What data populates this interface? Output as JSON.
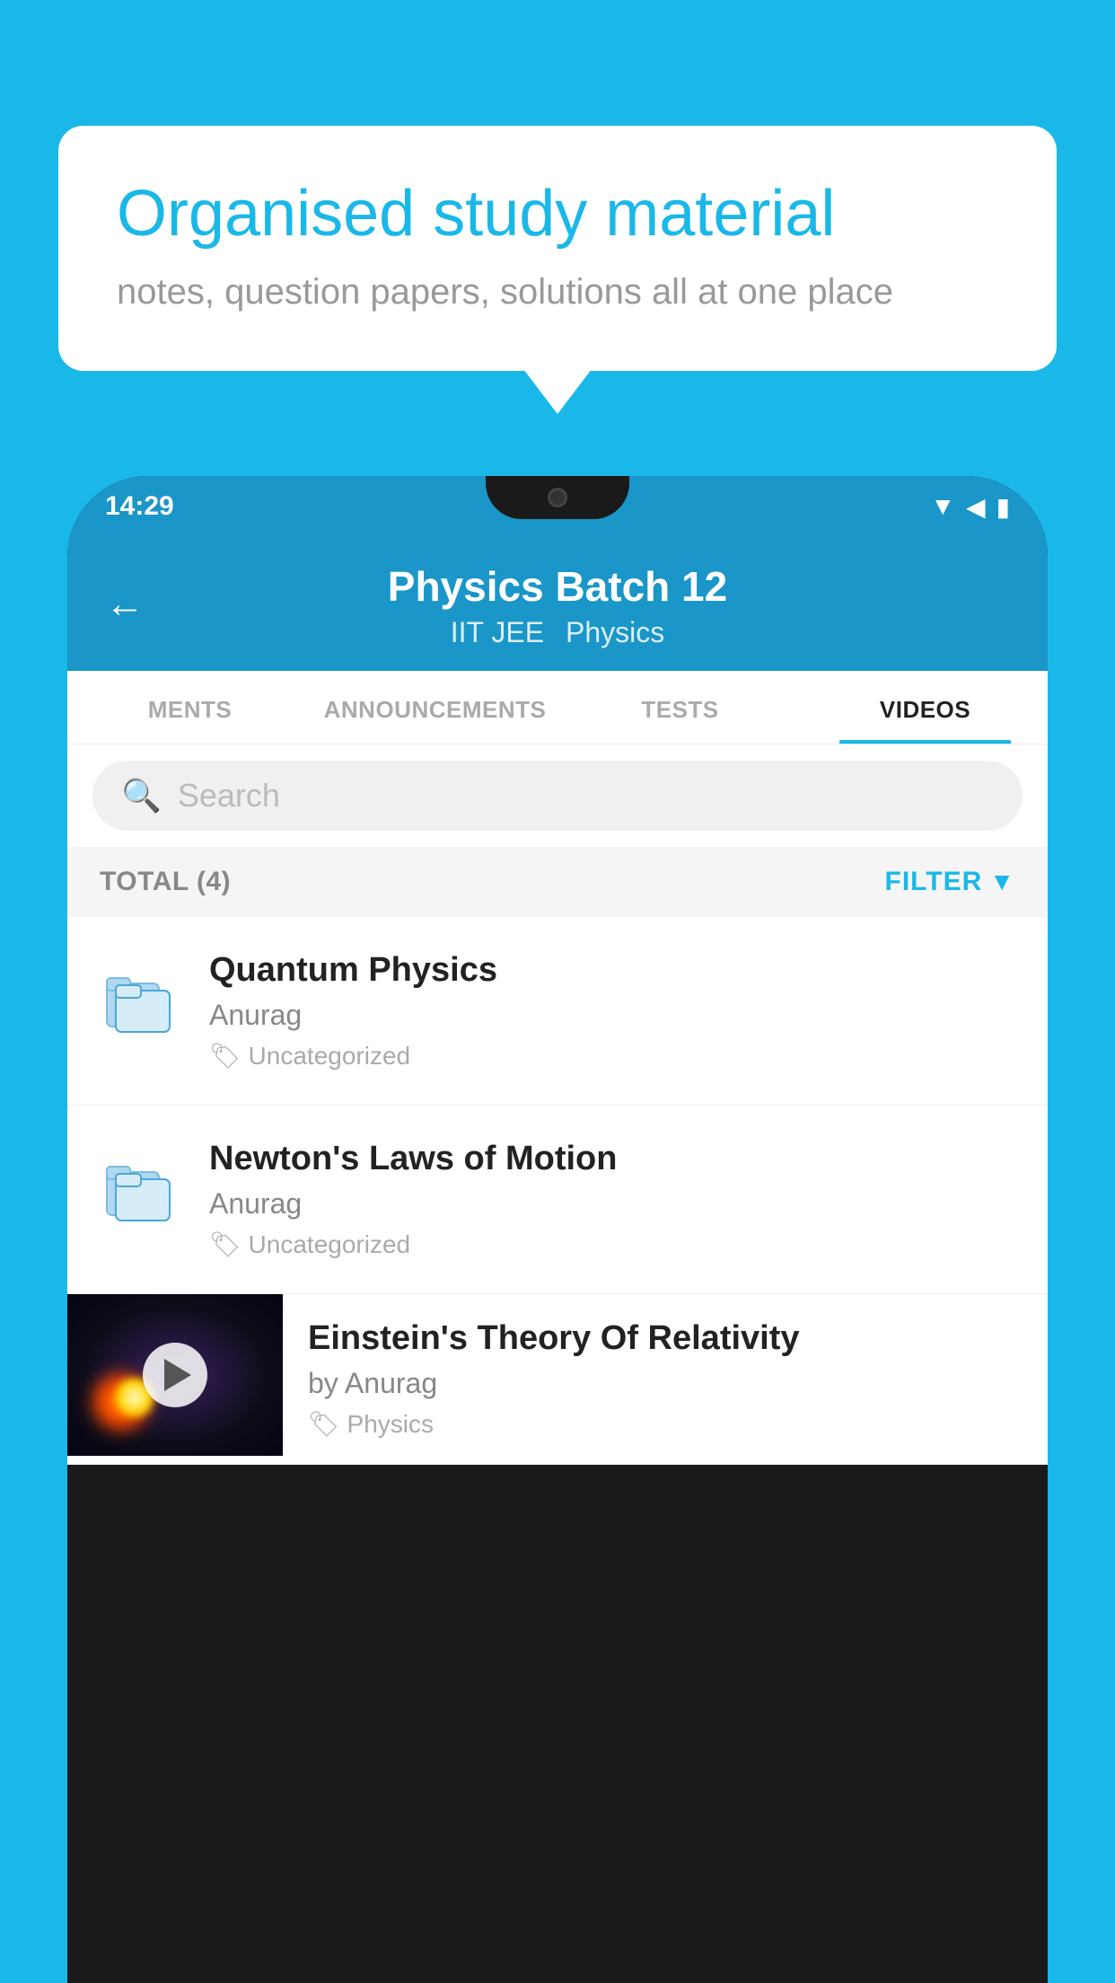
{
  "background": {
    "color": "#1ab8e8"
  },
  "speech_bubble": {
    "title": "Organised study material",
    "subtitle": "notes, question papers, solutions all at one place"
  },
  "status_bar": {
    "time": "14:29",
    "icons": [
      "wifi",
      "signal",
      "battery"
    ]
  },
  "app_header": {
    "title": "Physics Batch 12",
    "subtitle_part1": "IIT JEE",
    "subtitle_part2": "Physics",
    "back_label": "←"
  },
  "tabs": [
    {
      "label": "MENTS",
      "active": false
    },
    {
      "label": "ANNOUNCEMENTS",
      "active": false
    },
    {
      "label": "TESTS",
      "active": false
    },
    {
      "label": "VIDEOS",
      "active": true
    }
  ],
  "search": {
    "placeholder": "Search"
  },
  "total_row": {
    "label": "TOTAL (4)",
    "filter_label": "FILTER"
  },
  "list_items": [
    {
      "title": "Quantum Physics",
      "author": "Anurag",
      "tag": "Uncategorized",
      "type": "folder"
    },
    {
      "title": "Newton's Laws of Motion",
      "author": "Anurag",
      "tag": "Uncategorized",
      "type": "folder"
    }
  ],
  "video_item": {
    "title": "Einstein's Theory Of Relativity",
    "author": "by Anurag",
    "tag": "Physics",
    "type": "video"
  }
}
